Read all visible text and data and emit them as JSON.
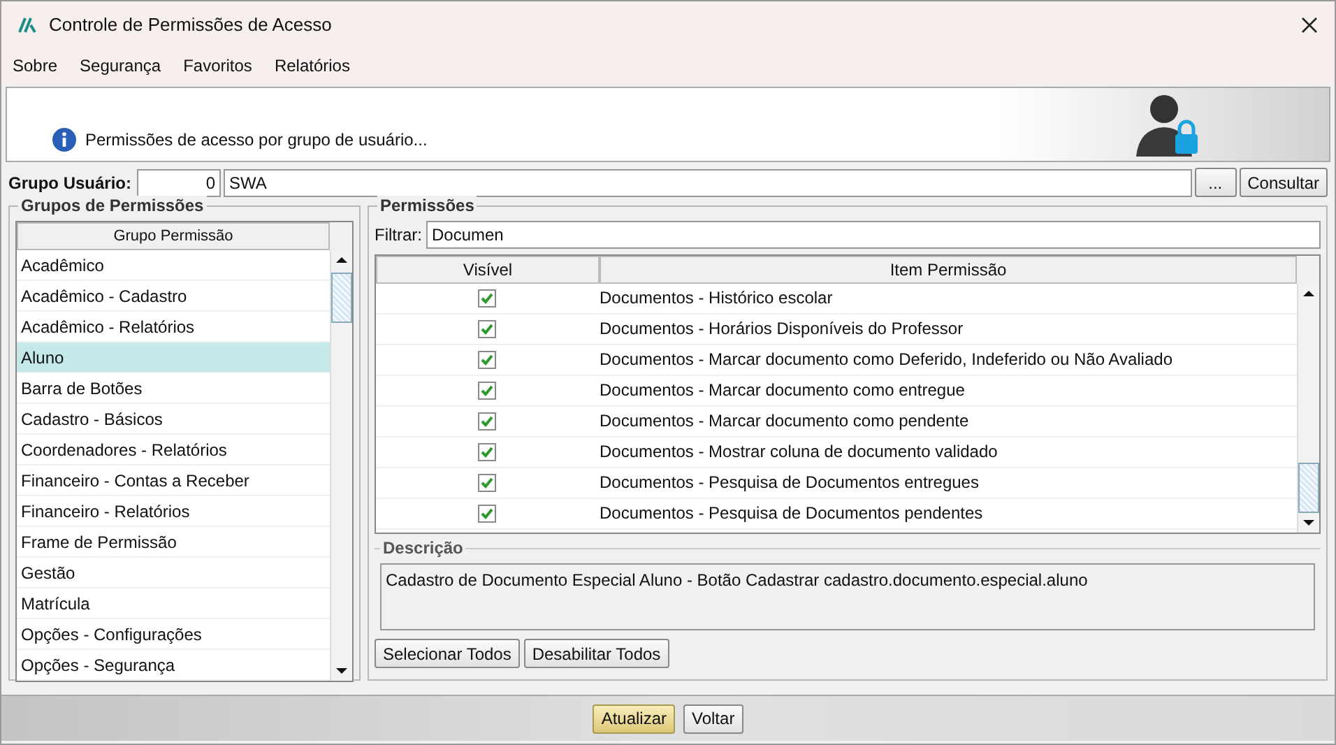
{
  "window": {
    "title": "Controle de Permissões de Acesso"
  },
  "menu": [
    "Sobre",
    "Segurança",
    "Favoritos",
    "Relatórios"
  ],
  "header": {
    "message": "Permissões de acesso por grupo de usuário..."
  },
  "user_group": {
    "label": "Grupo Usuário:",
    "code": "0",
    "name": "SWA",
    "browse_button": "...",
    "query_button": "Consultar"
  },
  "groups_panel": {
    "title": "Grupos de Permissões",
    "column": "Grupo Permissão",
    "items": [
      {
        "label": "Acadêmico",
        "selected": false
      },
      {
        "label": "Acadêmico - Cadastro",
        "selected": false
      },
      {
        "label": "Acadêmico - Relatórios",
        "selected": false
      },
      {
        "label": "Aluno",
        "selected": true
      },
      {
        "label": "Barra de Botões",
        "selected": false
      },
      {
        "label": "Cadastro - Básicos",
        "selected": false
      },
      {
        "label": "Coordenadores - Relatórios",
        "selected": false
      },
      {
        "label": "Financeiro - Contas a Receber",
        "selected": false
      },
      {
        "label": "Financeiro - Relatórios",
        "selected": false
      },
      {
        "label": "Frame de Permissão",
        "selected": false
      },
      {
        "label": "Gestão",
        "selected": false
      },
      {
        "label": "Matrícula",
        "selected": false
      },
      {
        "label": "Opções - Configurações",
        "selected": false
      },
      {
        "label": "Opções - Segurança",
        "selected": false
      }
    ]
  },
  "permissions_panel": {
    "title": "Permissões",
    "filter_label": "Filtrar:",
    "filter_value": "Documen",
    "columns": [
      "Visível",
      "Item Permissão"
    ],
    "rows": [
      {
        "visible": true,
        "item": "Documentos - Histórico escolar"
      },
      {
        "visible": true,
        "item": "Documentos - Horários Disponíveis do Professor"
      },
      {
        "visible": true,
        "item": "Documentos - Marcar documento como Deferido, Indeferido ou Não Avaliado"
      },
      {
        "visible": true,
        "item": "Documentos - Marcar documento como entregue"
      },
      {
        "visible": true,
        "item": "Documentos - Marcar documento como pendente"
      },
      {
        "visible": true,
        "item": "Documentos - Mostrar coluna de documento validado"
      },
      {
        "visible": true,
        "item": "Documentos - Pesquisa de Documentos entregues"
      },
      {
        "visible": true,
        "item": "Documentos - Pesquisa de Documentos pendentes"
      }
    ],
    "description_title": "Descrição",
    "description": "Cadastro de Documento Especial Aluno - Botão Cadastrar cadastro.documento.especial.aluno",
    "buttons": [
      "Selecionar Todos",
      "Desabilitar Todos"
    ]
  },
  "footer_buttons": [
    {
      "label": "Atualizar",
      "kind": "primary"
    },
    {
      "label": "Voltar",
      "kind": "normal"
    }
  ]
}
